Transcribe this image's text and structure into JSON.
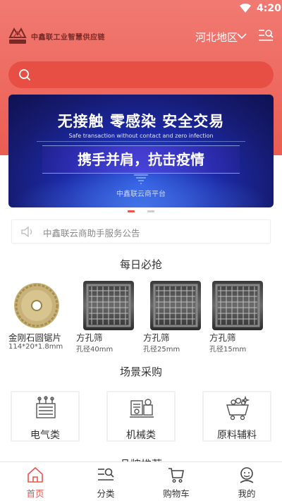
{
  "status_bar": {
    "time": "4:20"
  },
  "header": {
    "logo_text": "中鑫联工业智慧供应链",
    "logo_mark_text": "中鑫联",
    "region": "河北地区"
  },
  "search": {
    "placeholder": ""
  },
  "banner": {
    "title": "无接触  零感染  安全交易",
    "subtitle": "Safe transaction without contact and zero infection",
    "slogan": "携手并肩，抗击疫情",
    "platform": "中鑫联云商平台"
  },
  "carousel": {
    "total": 2,
    "active": 1
  },
  "notice": {
    "text": "中鑫联云商助手服务公告"
  },
  "daily_deals": {
    "title": "每日必抢",
    "items": [
      {
        "name": "金刚石圆锯片",
        "spec": "114*20*1.8mm"
      },
      {
        "name": "方孔筛",
        "spec": "孔径40mm"
      },
      {
        "name": "方孔筛",
        "spec": "孔径25mm"
      },
      {
        "name": "方孔筛",
        "spec": "孔径15mm"
      }
    ]
  },
  "scene_purchase": {
    "title": "场景采购",
    "categories": [
      {
        "label": "电气类",
        "icon": "transformer-icon"
      },
      {
        "label": "机械类",
        "icon": "machinery-icon"
      },
      {
        "label": "原料辅料",
        "icon": "material-cart-icon"
      }
    ]
  },
  "brand_recommend": {
    "title": "品牌推荐"
  },
  "tabbar": {
    "items": [
      {
        "label": "首页",
        "icon": "home-icon",
        "active": true
      },
      {
        "label": "分类",
        "icon": "category-icon",
        "active": false
      },
      {
        "label": "购物车",
        "icon": "cart-icon",
        "active": false
      },
      {
        "label": "我的",
        "icon": "profile-icon",
        "active": false
      }
    ]
  },
  "colors": {
    "brand": "#e9554b",
    "header_gradient_top": "#f07a72",
    "banner_blue": "#1c2aa8"
  }
}
